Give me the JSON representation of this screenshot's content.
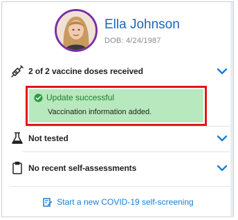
{
  "user": {
    "name": "Ella Johnson",
    "dob": "DOB: 4/24/1987"
  },
  "vaccine": {
    "label": "2 of 2 vaccine doses received"
  },
  "toast": {
    "title": "Update successful",
    "message": "Vaccination information added."
  },
  "testing": {
    "label": "Not tested"
  },
  "self_assessment": {
    "label": "No recent self-assessments"
  },
  "footer": {
    "link_label": "Start a new COVID-19 self-screening"
  },
  "colors": {
    "accent_blue": "#1a67b8",
    "chevron_blue": "#1a7ed1",
    "avatar_ring": "#7b2fa6",
    "toast_bg": "#b8e8bd",
    "toast_text": "#1d7f2e",
    "highlight_red": "#e3151a"
  },
  "icons": [
    "syringe-icon",
    "beaker-icon",
    "clipboard-icon",
    "chevron-down-icon",
    "check-circle-icon",
    "edit-form-icon"
  ]
}
